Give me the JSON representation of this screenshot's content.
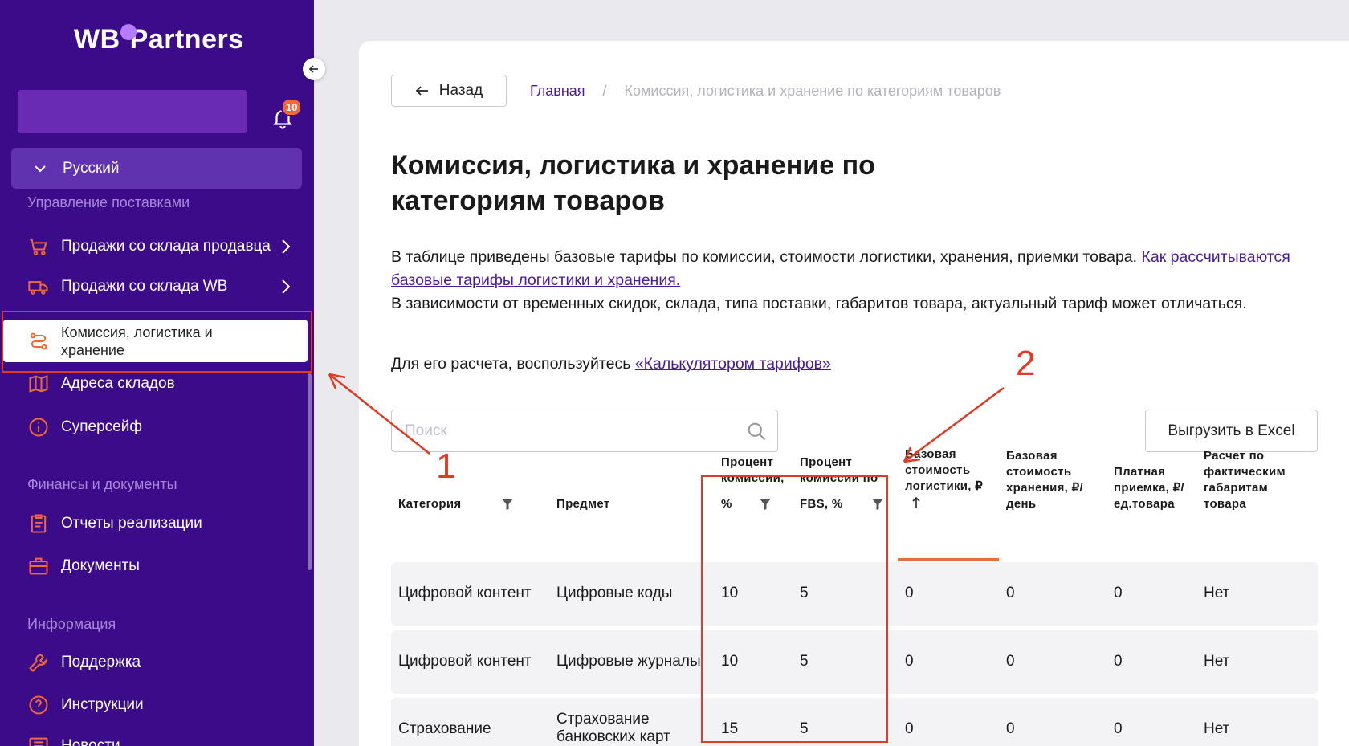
{
  "app": {
    "logo_left": "WB",
    "logo_right": "Partners"
  },
  "sidebar": {
    "notifications_count": "10",
    "language": "Русский",
    "sections": [
      {
        "title": "Управление поставками"
      },
      {
        "title": "Финансы и документы"
      },
      {
        "title": "Информация"
      }
    ],
    "items": {
      "sales_seller": "Продажи со склада продавца",
      "sales_wb": "Продажи со склада WB",
      "commission": "Комиссия, логистика и хранение",
      "warehouses": "Адреса складов",
      "supersafe": "Суперсейф",
      "reports": "Отчеты реализации",
      "documents": "Документы",
      "support": "Поддержка",
      "instructions": "Инструкции",
      "news": "Новости"
    }
  },
  "header": {
    "back_label": "Назад",
    "breadcrumb_home": "Главная",
    "breadcrumb_sep": "/",
    "breadcrumb_current": "Комиссия, логистика и хранение по категориям товаров"
  },
  "page": {
    "title": "Комиссия, логистика и хранение по категориям товаров",
    "desc_text": "В таблице приведены базовые тарифы по комиссии, стоимости логистики, хранения, приемки товара. ",
    "desc_link": "Как рассчитываются базовые тарифы логистики и хранения.",
    "desc_text2": "В зависимости от временных скидок, склада, типа поставки, габаритов товара, актуальный тариф может отличаться.",
    "calc_text": "Для его расчета, воспользуйтесь ",
    "calc_link": "«Калькулятором тарифов»",
    "search_placeholder": "Поиск",
    "export_label": "Выгрузить в Excel"
  },
  "table": {
    "headers": {
      "category": "Категория",
      "subject": "Предмет",
      "commission_l1": "Процент",
      "commission_l2": "комиссии,",
      "commission_l3": "%",
      "fbs_l1": "Процент",
      "fbs_l2": "комиссии по",
      "fbs_l3": "FBS, %",
      "logistics": "Базовая стоимость логистики, ₽",
      "storage": "Базовая стоимость хранения, ₽/день",
      "acceptance": "Платная приемка, ₽/ед.товара",
      "actual": "Расчет по фактическим габаритам товара"
    },
    "rows": [
      {
        "category": "Цифровой контент",
        "subject": "Цифровые коды",
        "commission": "10",
        "fbs": "5",
        "logistics": "0",
        "storage": "0",
        "acceptance": "0",
        "actual": "Нет"
      },
      {
        "category": "Цифровой контент",
        "subject": "Цифровые журналы",
        "commission": "10",
        "fbs": "5",
        "logistics": "0",
        "storage": "0",
        "acceptance": "0",
        "actual": "Нет"
      },
      {
        "category": "Страхование",
        "subject": "Страхование банковских карт",
        "commission": "15",
        "fbs": "5",
        "logistics": "0",
        "storage": "0",
        "acceptance": "0",
        "actual": "Нет"
      }
    ]
  },
  "annotations": {
    "label_1": "1",
    "label_2": "2",
    "color": "#e03b24"
  },
  "colors": {
    "sidebar_bg": "#3c0b8a",
    "accent": "#f0693a",
    "link": "#4a1a99"
  }
}
